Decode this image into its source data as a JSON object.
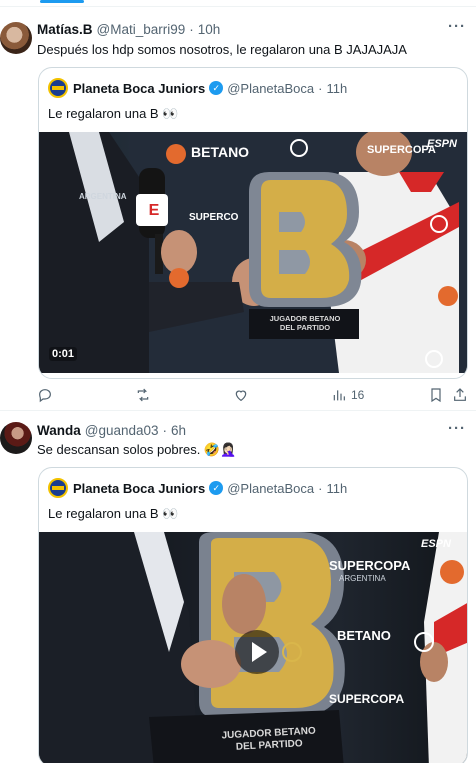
{
  "tweets": [
    {
      "author_name": "Matías.B",
      "handle": "@Mati_barri99",
      "time": "10h",
      "text": "Después los hdp somos nosotros, le regalaron una B JAJAJAJA",
      "more": "···",
      "quote": {
        "author_name": "Planeta Boca Juniors",
        "handle": "@PlanetaBoca",
        "time": "11h",
        "text": "Le regalaron una B 👀",
        "media": {
          "duration": "0:01",
          "overlay": {
            "sponsor_1": "BETANO",
            "sponsor_2": "SUPERCOPA",
            "sponsor_3": "SUPERCO",
            "sponsor_4": "ARGENTINA",
            "broadcaster": "ESPN",
            "trophy_line_1": "JUGADOR BETANO",
            "trophy_line_2": "DEL PARTIDO",
            "mic_badge": "E"
          }
        }
      },
      "stats": {
        "views": "16"
      }
    },
    {
      "author_name": "Wanda",
      "handle": "@guanda03",
      "time": "6h",
      "text": "Se descansan solos pobres. 🤣🤦🏻‍♀️",
      "more": "···",
      "quote": {
        "author_name": "Planeta Boca Juniors",
        "handle": "@PlanetaBoca",
        "time": "11h",
        "text": "Le regalaron una B 👀",
        "media": {
          "overlay": {
            "sponsor_1": "SUPERCOPA",
            "sponsor_2": "ARGENTINA",
            "sponsor_3": "BETANO",
            "sponsor_4": "SUPERCOPA",
            "broadcaster": "ESPN",
            "trophy_line_1": "JUGADOR BETANO",
            "trophy_line_2": "DEL PARTIDO"
          }
        }
      }
    }
  ],
  "icons": [
    "reply-icon",
    "retweet-icon",
    "like-icon",
    "views-icon",
    "bookmark-icon",
    "share-icon",
    "verified-badge-icon",
    "play-icon"
  ],
  "colors": {
    "accent": "#1d9bf0",
    "muted": "#536471",
    "border": "#cfd9de",
    "gold": "#d4ae48",
    "river_red": "#d62828"
  }
}
